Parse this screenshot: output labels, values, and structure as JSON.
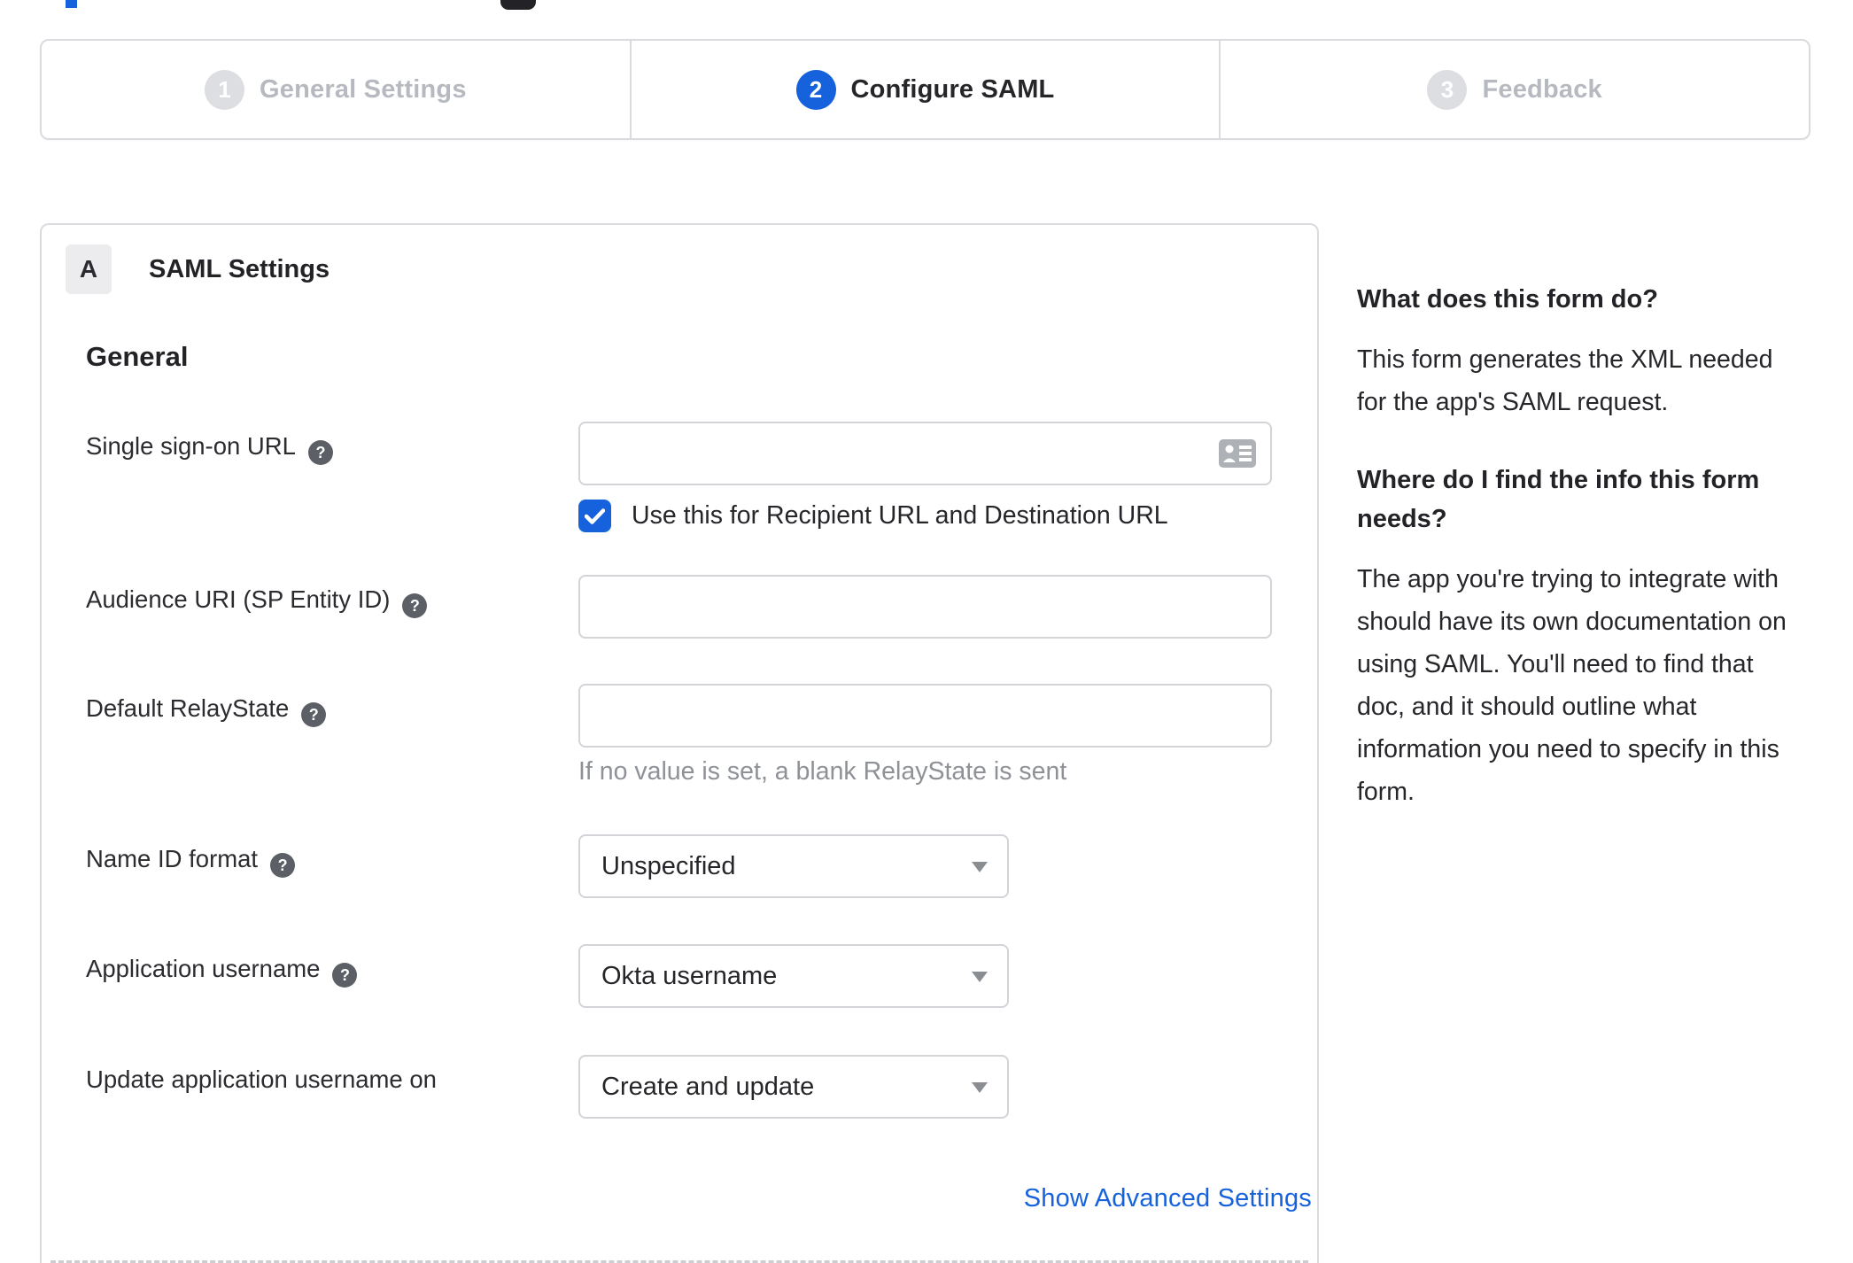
{
  "colors": {
    "accent": "#1662dd",
    "text": "#26262a",
    "muted": "#b6b9bf",
    "hint": "#8e9196",
    "border": "#d9dbde"
  },
  "stepper": {
    "steps": [
      {
        "number": "1",
        "label": "General Settings",
        "state": "inactive"
      },
      {
        "number": "2",
        "label": "Configure SAML",
        "state": "active"
      },
      {
        "number": "3",
        "label": "Feedback",
        "state": "inactive"
      }
    ]
  },
  "panel": {
    "badge": "A",
    "title": "SAML Settings",
    "section_heading": "General",
    "help_glyph": "?",
    "fields": [
      {
        "label": "Single sign-on URL",
        "value": ""
      },
      {
        "label": "Audience URI (SP Entity ID)",
        "value": ""
      },
      {
        "label": "Default RelayState",
        "value": "",
        "hint": "If no value is set, a blank RelayState is sent"
      },
      {
        "label": "Name ID format",
        "value": "Unspecified"
      },
      {
        "label": "Application username",
        "value": "Okta username"
      },
      {
        "label": "Update application username on",
        "value": "Create and update"
      }
    ],
    "sso_checkbox": {
      "checked": true,
      "label": "Use this for Recipient URL and Destination URL"
    },
    "advanced_link": "Show Advanced Settings"
  },
  "sidebar": {
    "heading1": "What does this form do?",
    "para1": "This form generates the XML needed for the app's SAML request.",
    "heading2": "Where do I find the info this form needs?",
    "para2": "The app you're trying to integrate with should have its own documentation on using SAML. You'll need to find that doc, and it should outline what information you need to specify in this form."
  }
}
